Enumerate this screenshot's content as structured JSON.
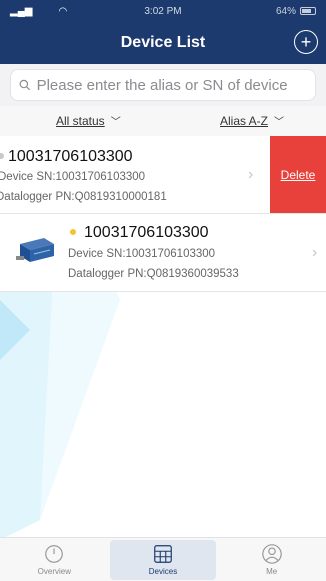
{
  "status_bar": {
    "time": "3:02 PM",
    "battery": "64%"
  },
  "header": {
    "title": "Device List",
    "add_icon": "plus-circle-icon"
  },
  "search": {
    "placeholder": "Please enter the alias or SN of device",
    "value": ""
  },
  "filters": {
    "status": "All status",
    "sort": "Alias A-Z"
  },
  "devices": [
    {
      "name": "10031706103300",
      "sn": "Device SN:10031706103300",
      "pn": "Datalogger PN:Q0819310000181",
      "status_color": "#c9c9cc",
      "delete_label": "Delete"
    },
    {
      "name": "10031706103300",
      "sn": "Device SN:10031706103300",
      "pn": "Datalogger PN:Q0819360039533",
      "status_color": "#f4c430"
    }
  ],
  "tabs": [
    {
      "label": "Overview",
      "icon": "gauge-icon",
      "active": false
    },
    {
      "label": "Devices",
      "icon": "device-grid-icon",
      "active": true
    },
    {
      "label": "Me",
      "icon": "person-icon",
      "active": false
    }
  ],
  "colors": {
    "accent": "#1c3a6e",
    "delete": "#e8403a"
  }
}
